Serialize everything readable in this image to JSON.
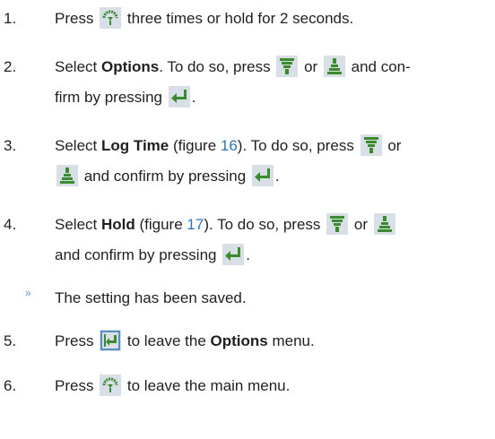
{
  "steps": [
    {
      "number": "1.",
      "before_icon": "Press ",
      "icon": "menu-icon",
      "after_icon": " three times or hold for 2 seconds."
    },
    {
      "number": "2.",
      "prefix": "Select ",
      "bold": "Options",
      "middle": ". To do so, press ",
      "icon_a": "down-arrow-icon",
      "or_text": " or ",
      "icon_b": "up-arrow-icon",
      "suffix": " and con-",
      "line2": "firm by pressing ",
      "icon_c": "enter-icon",
      "end": "."
    },
    {
      "number": "3.",
      "prefix": "Select ",
      "bold": "Log Time",
      "fig_open": " (figure ",
      "fig_num": "16",
      "fig_close": "). To do so, press ",
      "icon_a": "down-arrow-icon",
      "or_text": " or",
      "icon_b": "up-arrow-icon",
      "suffix": " and confirm by pressing ",
      "icon_c": "enter-icon",
      "end": "."
    },
    {
      "number": "4.",
      "prefix": "Select ",
      "bold": "Hold",
      "fig_open": " (figure ",
      "fig_num": "17",
      "fig_close": "). To do so, press ",
      "icon_a": "down-arrow-icon",
      "or_text": " or ",
      "icon_b": "up-arrow-icon",
      "line2": "and confirm by pressing ",
      "icon_c": "enter-icon",
      "end": "."
    },
    {
      "number": "5.",
      "before_icon": "Press ",
      "icon": "back-icon",
      "after_icon": " to leave the ",
      "bold": "Options",
      "end": " menu."
    },
    {
      "number": "6.",
      "before_icon": "Press ",
      "icon": "menu-icon",
      "after_icon": " to leave the main menu."
    }
  ],
  "result": {
    "bullet": "»",
    "text": "The setting has been saved."
  },
  "colors": {
    "text": "#1f1f1f",
    "link": "#2f75b5",
    "icon_green": "#3a8a2e",
    "icon_bg": "#d8dfe7",
    "bullet": "#6a8fbf"
  }
}
